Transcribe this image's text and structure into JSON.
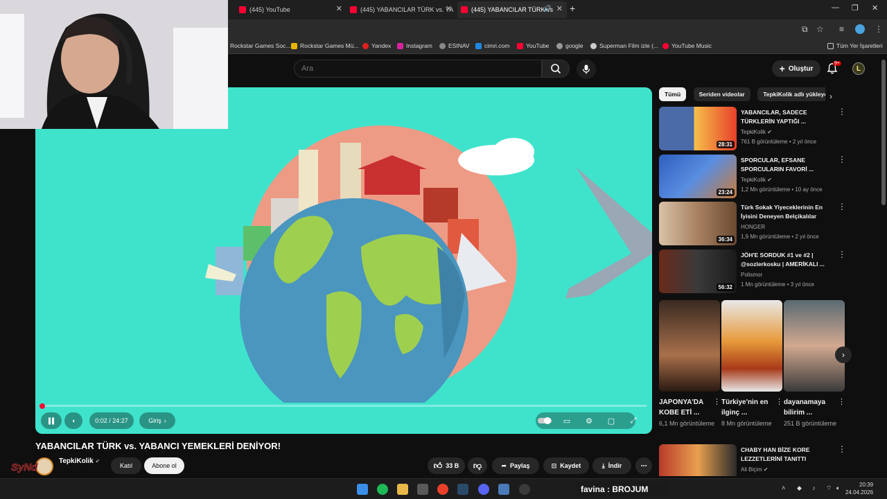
{
  "browser": {
    "tabs": [
      {
        "title": "(445) YouTube"
      },
      {
        "title": "(445) YABANCILAR TÜRK vs. YA"
      },
      {
        "title": "(445) YABANCILAR TÜRK vs"
      }
    ],
    "bookmarks": [
      {
        "label": "Rockstar Games Soc...",
        "icon": "rockstar-icon"
      },
      {
        "label": "Rockstar Games Mü...",
        "icon": "rockstar-icon"
      },
      {
        "label": "Yandex",
        "icon": "yandex-icon"
      },
      {
        "label": "Instagram",
        "icon": "instagram-icon"
      },
      {
        "label": "ESINAV",
        "icon": "globe-icon"
      },
      {
        "label": "cimri.com",
        "icon": "cimri-icon"
      },
      {
        "label": "YouTube",
        "icon": "youtube-icon"
      },
      {
        "label": "google",
        "icon": "google-icon"
      },
      {
        "label": "Superman Film izle (...",
        "icon": "superman-icon"
      },
      {
        "label": "YouTube Music",
        "icon": "youtube-music-icon"
      }
    ],
    "all_bookmarks": "Tüm Yer İşaretleri"
  },
  "header": {
    "search_placeholder": "Ara",
    "create_label": "Oluştur",
    "notification_count": "9+",
    "avatar_letter": "L"
  },
  "player": {
    "time": "0:02 / 24:27",
    "chapter": "Giriş",
    "progress_fraction": 0.0014
  },
  "video": {
    "title": "YABANCILAR TÜRK vs. YABANCI YEMEKLERİ DENİYOR!",
    "channel": "TepkiKolik",
    "join_label": "Katıl",
    "subscribe_label": "Abone ol",
    "likes": "33 B",
    "share_label": "Paylaş",
    "save_label": "Kaydet",
    "download_label": "İndir"
  },
  "chips": [
    "Tümü",
    "Seriden videolar",
    "TepkiKolik adlı yükleyen"
  ],
  "recommendations": [
    {
      "title": "YABANCILAR, SADECE TÜRKLERİN YAPTIĞI ...",
      "channel": "TepkiKolik",
      "meta": "761 B görüntüleme • 2 yıl önce",
      "duration": "28:31"
    },
    {
      "title": "SPORCULAR, EFSANE SPORCULARIN FAVORİ ...",
      "channel": "TepkiKolik",
      "meta": "1,2 Mn görüntüleme • 10 ay önce",
      "duration": "23:24"
    },
    {
      "title": "Türk Sokak Yiyeceklerinin En İyisini Deneyen Belçikalılar",
      "channel": "HONGER",
      "meta": "1,9 Mn görüntüleme • 2 yıl önce",
      "duration": "36:34"
    },
    {
      "title": "JÖH'E SORDUK #1 ve #2 | @sozlerkosku | AMERİKALI ...",
      "channel": "Polismor",
      "meta": "1 Mn görüntüleme • 3 yıl önce",
      "duration": "56:32"
    },
    {
      "title": "CHABY HAN BİZE KORE LEZZETLERİNİ TANITTI",
      "channel": "Ali Biçim",
      "meta": "",
      "duration": ""
    }
  ],
  "shorts": [
    {
      "title": "JAPONYA'DA KOBE ETİ ...",
      "views": "6,1 Mn görüntüleme"
    },
    {
      "title": "Türkiye'nin en ilginç ...",
      "views": "8 Mn görüntüleme"
    },
    {
      "title": "dayanamaya bilirim ...",
      "views": "251 B görüntüleme"
    }
  ],
  "taskbar": {
    "banner": "favina : BROJUM",
    "time": "20:39",
    "date": "24.04.2026"
  },
  "overlay_logo_text": "SyNd"
}
